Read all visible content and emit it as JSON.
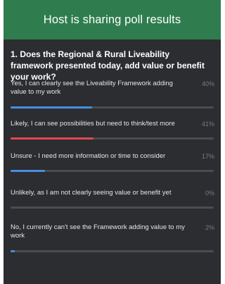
{
  "header": {
    "title": "Host is sharing poll results"
  },
  "poll": {
    "question": "1. Does the Regional & Rural Liveability framework presented today, add value or benefit your work?",
    "options": [
      {
        "label": "Yes, I can clearly see the Liveability Framework adding value to my work",
        "percent_label": "40%",
        "fraction": 0.4,
        "bar_color": "#4a8de0"
      },
      {
        "label": "Likely, I can see possibilities but need to think/test more",
        "percent_label": "41%",
        "fraction": 0.41,
        "bar_color": "#e0484f"
      },
      {
        "label": "Unsure - I need more information or time to consider",
        "percent_label": "17%",
        "fraction": 0.17,
        "bar_color": "#4a8de0"
      },
      {
        "label": "Unlikely, as I am not clearly seeing value or benefit yet",
        "percent_label": "0%",
        "fraction": 0.0,
        "bar_color": "#4a8de0"
      },
      {
        "label": "No, I currently can't see the Framework adding value to my work",
        "percent_label": "2%",
        "fraction": 0.02,
        "bar_color": "#4a8de0"
      }
    ]
  }
}
